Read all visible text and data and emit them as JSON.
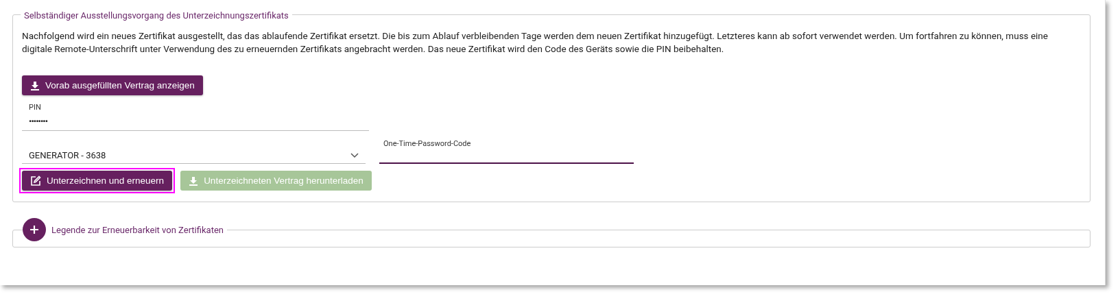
{
  "section": {
    "title": "Selbständiger Ausstellungsvorgang des Unterzeichnungszertifikats",
    "description": "Nachfolgend wird ein neues Zertifikat ausgestellt, das das ablaufende Zertifikat ersetzt. Die bis zum Ablauf verbleibenden Tage werden dem neuen Zertifikat hinzugefügt. Letzteres kann ab sofort verwendet werden. Um fortfahren zu können, muss eine digitale Remote-Unterschrift unter Verwendung des zu erneuernden Zertifikats angebracht werden. Das neue Zertifikat wird den Code des Geräts sowie die PIN beibehalten.",
    "preview_button": "Vorab ausgefüllten Vertrag anzeigen",
    "pin": {
      "label": "PIN",
      "value": "••••••••"
    },
    "device_select": {
      "value": "GENERATOR - 3638"
    },
    "otp": {
      "label": "One-Time-Password-Code",
      "focused": true
    },
    "actions": [
      {
        "label": "Unterzeichnen und erneuern",
        "kind": "sign",
        "disabled": false,
        "highlighted": true
      },
      {
        "label": "Unterzeichneten Vertrag herunterladen",
        "kind": "download",
        "disabled": true,
        "highlighted": false
      }
    ]
  },
  "legend_section": {
    "title": "Legende zur Erneuerbarkeit von Zertifikaten",
    "expanded": false
  }
}
